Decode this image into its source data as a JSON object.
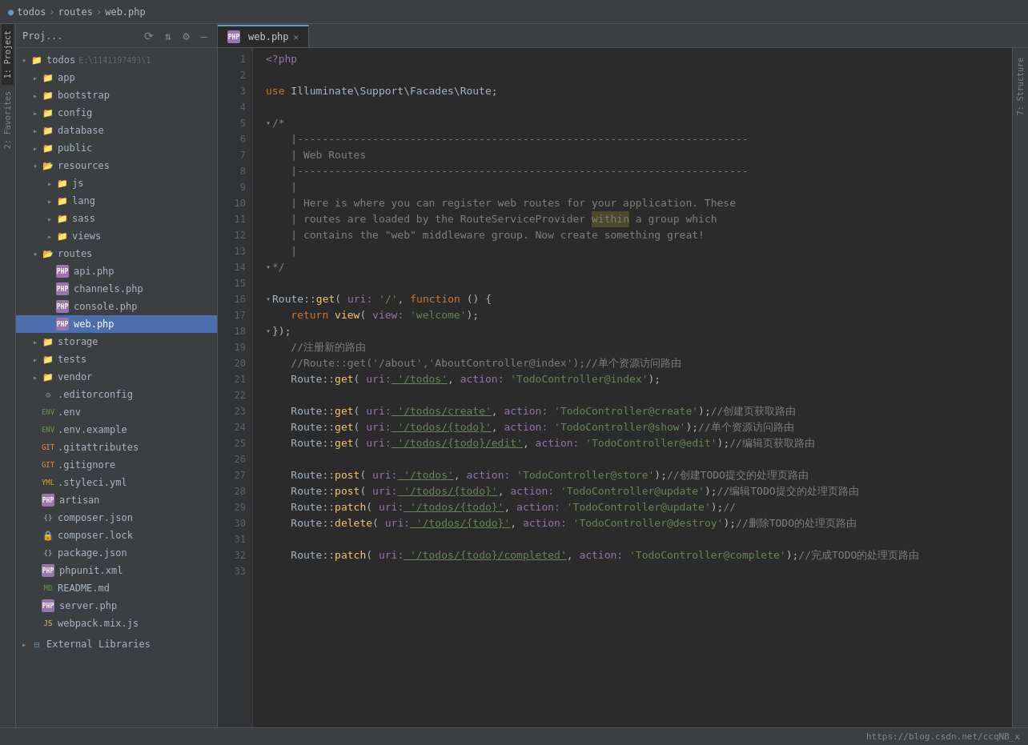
{
  "titleBar": {
    "project": "todos",
    "sep1": "›",
    "routes": "routes",
    "sep2": "›",
    "file": "web.php"
  },
  "sidebar": {
    "title": "Proj...",
    "rootItem": {
      "name": "todos",
      "path": "E:\\1141197493\\1"
    },
    "items": [
      {
        "id": "app",
        "label": "app",
        "indent": 1,
        "type": "folder",
        "open": false
      },
      {
        "id": "bootstrap",
        "label": "bootstrap",
        "indent": 1,
        "type": "folder",
        "open": false
      },
      {
        "id": "config",
        "label": "config",
        "indent": 1,
        "type": "folder",
        "open": false
      },
      {
        "id": "database",
        "label": "database",
        "indent": 1,
        "type": "folder",
        "open": false
      },
      {
        "id": "public",
        "label": "public",
        "indent": 1,
        "type": "folder",
        "open": false
      },
      {
        "id": "resources",
        "label": "resources",
        "indent": 1,
        "type": "folder",
        "open": true
      },
      {
        "id": "js",
        "label": "js",
        "indent": 2,
        "type": "folder",
        "open": false
      },
      {
        "id": "lang",
        "label": "lang",
        "indent": 2,
        "type": "folder",
        "open": false
      },
      {
        "id": "sass",
        "label": "sass",
        "indent": 2,
        "type": "folder",
        "open": false
      },
      {
        "id": "views",
        "label": "views",
        "indent": 2,
        "type": "folder",
        "open": false
      },
      {
        "id": "routes",
        "label": "routes",
        "indent": 1,
        "type": "folder",
        "open": true
      },
      {
        "id": "api.php",
        "label": "api.php",
        "indent": 2,
        "type": "php"
      },
      {
        "id": "channels.php",
        "label": "channels.php",
        "indent": 2,
        "type": "php"
      },
      {
        "id": "console.php",
        "label": "console.php",
        "indent": 2,
        "type": "php"
      },
      {
        "id": "web.php",
        "label": "web.php",
        "indent": 2,
        "type": "php",
        "selected": true
      },
      {
        "id": "storage",
        "label": "storage",
        "indent": 1,
        "type": "folder",
        "open": false
      },
      {
        "id": "tests",
        "label": "tests",
        "indent": 1,
        "type": "folder-green",
        "open": false
      },
      {
        "id": "vendor",
        "label": "vendor",
        "indent": 1,
        "type": "folder",
        "open": false
      },
      {
        "id": ".editorconfig",
        "label": ".editorconfig",
        "indent": 1,
        "type": "xml"
      },
      {
        "id": ".env",
        "label": ".env",
        "indent": 1,
        "type": "env"
      },
      {
        "id": ".env.example",
        "label": ".env.example",
        "indent": 1,
        "type": "env"
      },
      {
        "id": ".gitattributes",
        "label": ".gitattributes",
        "indent": 1,
        "type": "gitattr"
      },
      {
        "id": ".gitignore",
        "label": ".gitignore",
        "indent": 1,
        "type": "gitattr"
      },
      {
        "id": ".styleci.yml",
        "label": ".styleci.yml",
        "indent": 1,
        "type": "yaml"
      },
      {
        "id": "artisan",
        "label": "artisan",
        "indent": 1,
        "type": "php"
      },
      {
        "id": "composer.json",
        "label": "composer.json",
        "indent": 1,
        "type": "json"
      },
      {
        "id": "composer.lock",
        "label": "composer.lock",
        "indent": 1,
        "type": "lock"
      },
      {
        "id": "package.json",
        "label": "package.json",
        "indent": 1,
        "type": "json"
      },
      {
        "id": "phpunit.xml",
        "label": "phpunit.xml",
        "indent": 1,
        "type": "xml"
      },
      {
        "id": "README.md",
        "label": "README.md",
        "indent": 1,
        "type": "md"
      },
      {
        "id": "server.php",
        "label": "server.php",
        "indent": 1,
        "type": "php"
      },
      {
        "id": "webpack.mix.js",
        "label": "webpack.mix.js",
        "indent": 1,
        "type": "js"
      }
    ]
  },
  "tabs": [
    {
      "label": "web.php",
      "active": true,
      "type": "php"
    }
  ],
  "editor": {
    "filename": "web.php",
    "lines": [
      {
        "num": 1,
        "tokens": [
          {
            "t": "<?php",
            "c": "ph"
          }
        ]
      },
      {
        "num": 2,
        "tokens": []
      },
      {
        "num": 3,
        "tokens": [
          {
            "t": "use ",
            "c": "kw"
          },
          {
            "t": "Illuminate\\Support\\Facades\\Route",
            "c": "cl"
          },
          {
            "t": ";",
            "c": "pn"
          }
        ]
      },
      {
        "num": 4,
        "tokens": []
      },
      {
        "num": 5,
        "tokens": [
          {
            "t": "▾",
            "c": "fold-arrow"
          },
          {
            "t": "/*",
            "c": "cm"
          }
        ]
      },
      {
        "num": 6,
        "tokens": [
          {
            "t": "|------------------------------------------------------------------------",
            "c": "cm"
          }
        ]
      },
      {
        "num": 7,
        "tokens": [
          {
            "t": "| Web Routes",
            "c": "cm"
          }
        ]
      },
      {
        "num": 8,
        "tokens": [
          {
            "t": "|------------------------------------------------------------------------",
            "c": "cm"
          }
        ]
      },
      {
        "num": 9,
        "tokens": [
          {
            "t": "|",
            "c": "cm"
          }
        ]
      },
      {
        "num": 10,
        "tokens": [
          {
            "t": "| Here is where you can register web routes for your application. These",
            "c": "cm"
          }
        ]
      },
      {
        "num": 11,
        "tokens": [
          {
            "t": "| routes are loaded by the RouteServiceProvider within a group which",
            "c": "cm"
          }
        ]
      },
      {
        "num": 12,
        "tokens": [
          {
            "t": "| contains the \"web\" middleware group. Now create something great!",
            "c": "cm"
          }
        ]
      },
      {
        "num": 13,
        "tokens": [
          {
            "t": "|",
            "c": "cm"
          }
        ]
      },
      {
        "num": 14,
        "tokens": [
          {
            "t": "▾",
            "c": "fold-arrow"
          },
          {
            "t": "*/",
            "c": "cm"
          }
        ]
      },
      {
        "num": 15,
        "tokens": []
      },
      {
        "num": 16,
        "tokens": [
          {
            "t": "▾",
            "c": "fold-arrow"
          },
          {
            "t": "Route",
            "c": "cl"
          },
          {
            "t": "::",
            "c": "pn"
          },
          {
            "t": "get",
            "c": "fn"
          },
          {
            "t": "( ",
            "c": "pn"
          },
          {
            "t": "uri:",
            "c": "lbl"
          },
          {
            "t": " '/'",
            "c": "st"
          },
          {
            "t": ", ",
            "c": "pn"
          },
          {
            "t": "function",
            "c": "kw"
          },
          {
            "t": " () {",
            "c": "pn"
          }
        ]
      },
      {
        "num": 17,
        "tokens": [
          {
            "t": "    return ",
            "c": "kw"
          },
          {
            "t": "view",
            "c": "fn"
          },
          {
            "t": "( ",
            "c": "pn"
          },
          {
            "t": "view:",
            "c": "lbl"
          },
          {
            "t": " 'welcome'",
            "c": "st"
          },
          {
            "t": ");",
            "c": "pn"
          }
        ]
      },
      {
        "num": 18,
        "tokens": [
          {
            "t": "▾",
            "c": "fold-arrow"
          },
          {
            "t": "});",
            "c": "pn"
          }
        ]
      },
      {
        "num": 19,
        "tokens": [
          {
            "t": "    //注册新的路由",
            "c": "cm"
          }
        ]
      },
      {
        "num": 20,
        "tokens": [
          {
            "t": "    //Route::get('/about','AboutController@index');//单个资源访问路由",
            "c": "cm"
          }
        ]
      },
      {
        "num": 21,
        "tokens": [
          {
            "t": "    Route",
            "c": "cl"
          },
          {
            "t": "::",
            "c": "pn"
          },
          {
            "t": "get",
            "c": "fn"
          },
          {
            "t": "( ",
            "c": "pn"
          },
          {
            "t": "uri:",
            "c": "uri-lbl"
          },
          {
            "t": " '/todos'",
            "c": "uri-val"
          },
          {
            "t": ", ",
            "c": "pn"
          },
          {
            "t": "action:",
            "c": "action-lbl"
          },
          {
            "t": " 'TodoController@index'",
            "c": "action-val"
          },
          {
            "t": ");",
            "c": "pn"
          }
        ]
      },
      {
        "num": 22,
        "tokens": []
      },
      {
        "num": 23,
        "tokens": [
          {
            "t": "    Route",
            "c": "cl"
          },
          {
            "t": "::",
            "c": "pn"
          },
          {
            "t": "get",
            "c": "fn"
          },
          {
            "t": "( ",
            "c": "pn"
          },
          {
            "t": "uri:",
            "c": "uri-lbl"
          },
          {
            "t": " '/todos/create'",
            "c": "uri-val"
          },
          {
            "t": ", ",
            "c": "pn"
          },
          {
            "t": "action:",
            "c": "action-lbl"
          },
          {
            "t": " 'TodoController@create'",
            "c": "action-val"
          },
          {
            "t": ");//创建页获取路由",
            "c": "cm"
          }
        ]
      },
      {
        "num": 24,
        "tokens": [
          {
            "t": "    Route",
            "c": "cl"
          },
          {
            "t": "::",
            "c": "pn"
          },
          {
            "t": "get",
            "c": "fn"
          },
          {
            "t": "( ",
            "c": "pn"
          },
          {
            "t": "uri:",
            "c": "uri-lbl"
          },
          {
            "t": " '/todos/{todo}'",
            "c": "uri-val"
          },
          {
            "t": ", ",
            "c": "pn"
          },
          {
            "t": "action:",
            "c": "action-lbl"
          },
          {
            "t": " 'TodoController@show'",
            "c": "action-val"
          },
          {
            "t": ");//单个资源访问路由",
            "c": "cm"
          }
        ]
      },
      {
        "num": 25,
        "tokens": [
          {
            "t": "    Route",
            "c": "cl"
          },
          {
            "t": "::",
            "c": "pn"
          },
          {
            "t": "get",
            "c": "fn"
          },
          {
            "t": "( ",
            "c": "pn"
          },
          {
            "t": "uri:",
            "c": "uri-lbl"
          },
          {
            "t": " '/todos/{todo}/edit'",
            "c": "uri-val"
          },
          {
            "t": ", ",
            "c": "pn"
          },
          {
            "t": "action:",
            "c": "action-lbl"
          },
          {
            "t": " 'TodoController@edit'",
            "c": "action-val"
          },
          {
            "t": ");//编辑页获取路由",
            "c": "cm"
          }
        ]
      },
      {
        "num": 26,
        "tokens": []
      },
      {
        "num": 27,
        "tokens": [
          {
            "t": "    Route",
            "c": "cl"
          },
          {
            "t": "::",
            "c": "pn"
          },
          {
            "t": "post",
            "c": "fn"
          },
          {
            "t": "( ",
            "c": "pn"
          },
          {
            "t": "uri:",
            "c": "uri-lbl"
          },
          {
            "t": " '/todos'",
            "c": "uri-val"
          },
          {
            "t": ", ",
            "c": "pn"
          },
          {
            "t": "action:",
            "c": "action-lbl"
          },
          {
            "t": " 'TodoController@store'",
            "c": "action-val"
          },
          {
            "t": ");//创建TODO提交的处理页路由",
            "c": "cm"
          }
        ]
      },
      {
        "num": 28,
        "tokens": [
          {
            "t": "    Route",
            "c": "cl"
          },
          {
            "t": "::",
            "c": "pn"
          },
          {
            "t": "post",
            "c": "fn"
          },
          {
            "t": "( ",
            "c": "pn"
          },
          {
            "t": "uri:",
            "c": "uri-lbl"
          },
          {
            "t": " '/todos/{todo}'",
            "c": "uri-val"
          },
          {
            "t": ", ",
            "c": "pn"
          },
          {
            "t": "action:",
            "c": "action-lbl"
          },
          {
            "t": " 'TodoController@update'",
            "c": "action-val"
          },
          {
            "t": ");//编辑TODO提交的处理页路由",
            "c": "cm"
          }
        ]
      },
      {
        "num": 29,
        "tokens": [
          {
            "t": "    Route",
            "c": "cl"
          },
          {
            "t": "::",
            "c": "pn"
          },
          {
            "t": "patch",
            "c": "fn"
          },
          {
            "t": "( ",
            "c": "pn"
          },
          {
            "t": "uri:",
            "c": "uri-lbl"
          },
          {
            "t": " '/todos/{todo}'",
            "c": "uri-val"
          },
          {
            "t": ", ",
            "c": "pn"
          },
          {
            "t": "action:",
            "c": "action-lbl"
          },
          {
            "t": " 'TodoController@update'",
            "c": "action-val"
          },
          {
            "t": ");//",
            "c": "cm"
          }
        ]
      },
      {
        "num": 30,
        "tokens": [
          {
            "t": "    Route",
            "c": "cl"
          },
          {
            "t": "::",
            "c": "pn"
          },
          {
            "t": "delete",
            "c": "fn"
          },
          {
            "t": "( ",
            "c": "pn"
          },
          {
            "t": "uri:",
            "c": "uri-lbl"
          },
          {
            "t": " '/todos/{todo}'",
            "c": "uri-val"
          },
          {
            "t": ", ",
            "c": "pn"
          },
          {
            "t": "action:",
            "c": "action-lbl"
          },
          {
            "t": " 'TodoController@destroy'",
            "c": "action-val"
          },
          {
            "t": ");//删除TODO的处理页路由",
            "c": "cm"
          }
        ]
      },
      {
        "num": 31,
        "tokens": []
      },
      {
        "num": 32,
        "tokens": [
          {
            "t": "    Route",
            "c": "cl"
          },
          {
            "t": "::",
            "c": "pn"
          },
          {
            "t": "patch",
            "c": "fn"
          },
          {
            "t": "( ",
            "c": "pn"
          },
          {
            "t": "uri:",
            "c": "uri-lbl"
          },
          {
            "t": " '/todos/{todo}/completed'",
            "c": "uri-val"
          },
          {
            "t": ", ",
            "c": "pn"
          },
          {
            "t": "action:",
            "c": "action-lbl"
          },
          {
            "t": " 'TodoController@complete'",
            "c": "action-val"
          },
          {
            "t": ");//完成TODO的处理页路由",
            "c": "cm"
          }
        ]
      },
      {
        "num": 33,
        "tokens": []
      }
    ]
  },
  "leftTabs": [
    {
      "label": "1: Project",
      "active": true
    },
    {
      "label": "2: Favorites",
      "active": false
    }
  ],
  "rightTabs": [
    {
      "label": "7: Structure",
      "active": false
    }
  ],
  "statusBar": {
    "url": "https://blog.csdn.net/ccqNB_x"
  },
  "bottomBar": {
    "externalLibraries": "External Libraries"
  }
}
